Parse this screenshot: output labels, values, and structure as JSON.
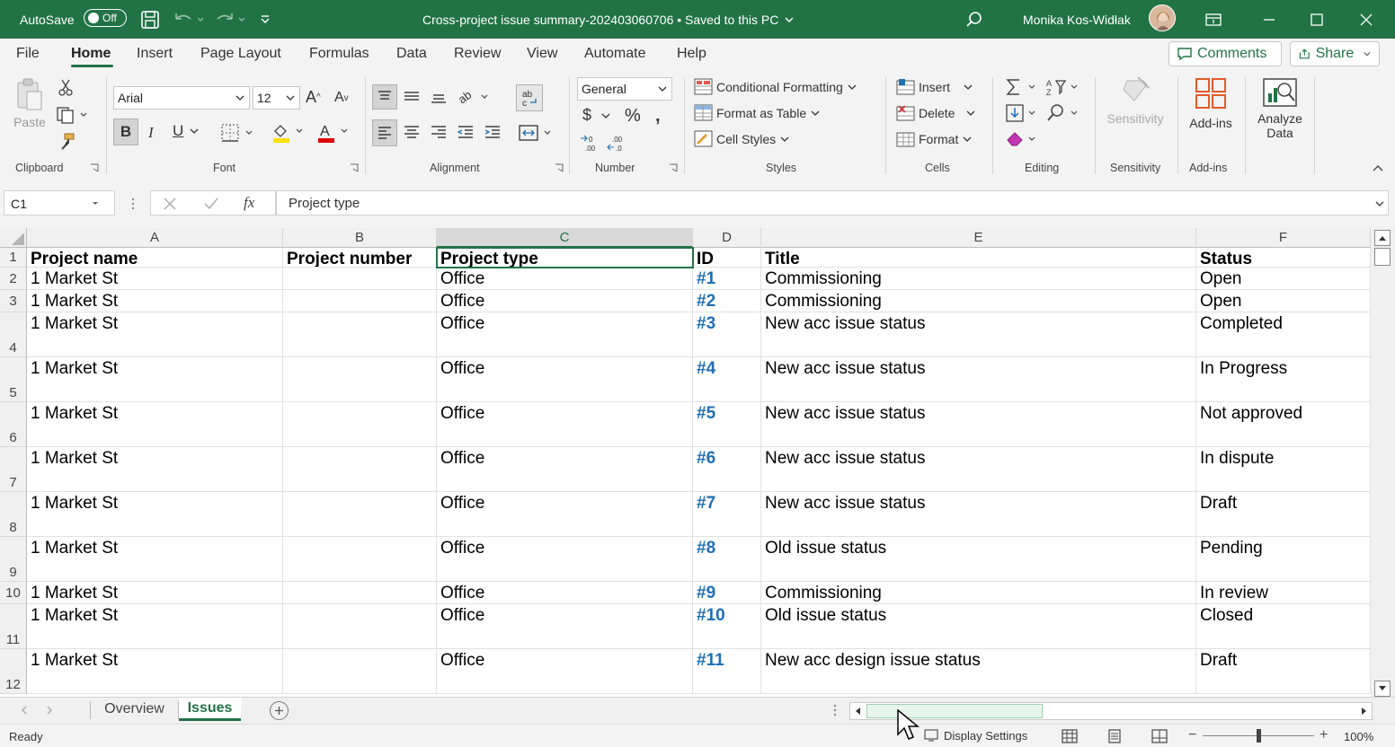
{
  "titlebar": {
    "autosave_label": "AutoSave",
    "autosave_state": "Off",
    "doc_title": "Cross-project issue summary-202403060706 • Saved to this PC",
    "user_name": "Monika Kos-Widłak"
  },
  "menu": {
    "items": [
      "File",
      "Home",
      "Insert",
      "Page Layout",
      "Formulas",
      "Data",
      "Review",
      "View",
      "Automate",
      "Help"
    ],
    "active": "Home",
    "comments_label": "Comments",
    "share_label": "Share"
  },
  "ribbon": {
    "clipboard": {
      "paste": "Paste",
      "label": "Clipboard"
    },
    "font": {
      "name": "Arial",
      "size": "12",
      "label": "Font"
    },
    "alignment": {
      "label": "Alignment"
    },
    "number": {
      "format": "General",
      "label": "Number"
    },
    "styles": {
      "conditional": "Conditional Formatting",
      "format_table": "Format as Table",
      "cell_styles": "Cell Styles",
      "label": "Styles"
    },
    "cells": {
      "insert": "Insert",
      "delete": "Delete",
      "format": "Format",
      "label": "Cells"
    },
    "editing": {
      "label": "Editing"
    },
    "sensitivity": {
      "button": "Sensitivity",
      "label": "Sensitivity"
    },
    "addins": {
      "button": "Add-ins",
      "label": "Add-ins"
    },
    "analyze": {
      "line1": "Analyze",
      "line2": "Data"
    }
  },
  "formula_bar": {
    "name_box": "C1",
    "formula": "Project type"
  },
  "sheet": {
    "columns": [
      "A",
      "B",
      "C",
      "D",
      "E",
      "F"
    ],
    "selected_column": "C",
    "header_row": [
      "Project name",
      "Project number",
      "Project type",
      "ID",
      "Title",
      "Status"
    ],
    "rows": [
      {
        "num": "2",
        "a": "1 Market St",
        "b": "",
        "c": "Office",
        "d": "#1",
        "e": "Commissioning",
        "f": "Open"
      },
      {
        "num": "3",
        "a": "1 Market St",
        "b": "",
        "c": "Office",
        "d": "#2",
        "e": "Commissioning",
        "f": "Open"
      },
      {
        "num": "4",
        "a": "1 Market St",
        "b": "",
        "c": "Office",
        "d": "#3",
        "e": "New acc issue status",
        "f": "Completed"
      },
      {
        "num": "5",
        "a": "1 Market St",
        "b": "",
        "c": "Office",
        "d": "#4",
        "e": "New acc issue status",
        "f": "In Progress"
      },
      {
        "num": "6",
        "a": "1 Market St",
        "b": "",
        "c": "Office",
        "d": "#5",
        "e": "New acc issue status",
        "f": "Not approved"
      },
      {
        "num": "7",
        "a": "1 Market St",
        "b": "",
        "c": "Office",
        "d": "#6",
        "e": "New acc issue status",
        "f": "In dispute"
      },
      {
        "num": "8",
        "a": "1 Market St",
        "b": "",
        "c": "Office",
        "d": "#7",
        "e": "New acc issue status",
        "f": "Draft"
      },
      {
        "num": "9",
        "a": "1 Market St",
        "b": "",
        "c": "Office",
        "d": "#8",
        "e": "Old issue status",
        "f": "Pending"
      },
      {
        "num": "10",
        "a": "1 Market St",
        "b": "",
        "c": "Office",
        "d": "#9",
        "e": "Commissioning",
        "f": "In review"
      },
      {
        "num": "11",
        "a": "1 Market St",
        "b": "",
        "c": "Office",
        "d": "#10",
        "e": "Old issue status",
        "f": "Closed"
      },
      {
        "num": "12",
        "a": "1 Market St",
        "b": "",
        "c": "Office",
        "d": "#11",
        "e": "New acc design issue status",
        "f": "Draft"
      }
    ]
  },
  "sheet_tabs": {
    "tabs": [
      "Overview",
      "Issues"
    ],
    "active": "Issues"
  },
  "status": {
    "ready": "Ready",
    "display_settings": "Display Settings",
    "zoom": "100%"
  },
  "colors": {
    "excel_green": "#217346",
    "id_blue": "#1f6fb5"
  }
}
